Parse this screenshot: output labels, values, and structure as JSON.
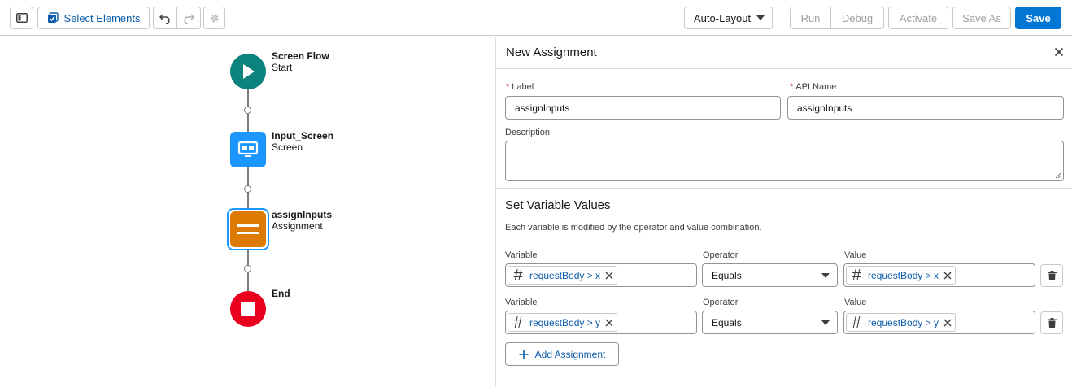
{
  "toolbar": {
    "select_elements_label": "Select Elements",
    "auto_layout_label": "Auto-Layout",
    "run_label": "Run",
    "debug_label": "Debug",
    "activate_label": "Activate",
    "save_as_label": "Save As",
    "save_label": "Save"
  },
  "canvas": {
    "nodes": [
      {
        "title": "Screen Flow",
        "subtitle": "Start",
        "type": "start",
        "color": "#0b827c"
      },
      {
        "title": "Input_Screen",
        "subtitle": "Screen",
        "type": "screen",
        "color": "#1b96ff"
      },
      {
        "title": "assignInputs",
        "subtitle": "Assignment",
        "type": "assignment",
        "color": "#dd7a01"
      },
      {
        "title": "End",
        "subtitle": "",
        "type": "end",
        "color": "#ea001e"
      }
    ]
  },
  "panel": {
    "title": "New Assignment",
    "label_field": {
      "label": "Label",
      "value": "assignInputs"
    },
    "api_name_field": {
      "label": "API Name",
      "value": "assignInputs"
    },
    "description_field": {
      "label": "Description",
      "value": ""
    },
    "section_title": "Set Variable Values",
    "section_description": "Each variable is modified by the operator and value combination.",
    "rows": [
      {
        "variable_label": "Variable",
        "variable": "requestBody > x",
        "operator_label": "Operator",
        "operator": "Equals",
        "value_label": "Value",
        "value": "requestBody > x"
      },
      {
        "variable_label": "Variable",
        "variable": "requestBody > y",
        "operator_label": "Operator",
        "operator": "Equals",
        "value_label": "Value",
        "value": "requestBody > y"
      }
    ],
    "add_assignment_label": "Add Assignment"
  },
  "colors": {
    "brand_blue": "#0176d3",
    "link_blue": "#0b5cab",
    "required_red": "#ba0517"
  }
}
